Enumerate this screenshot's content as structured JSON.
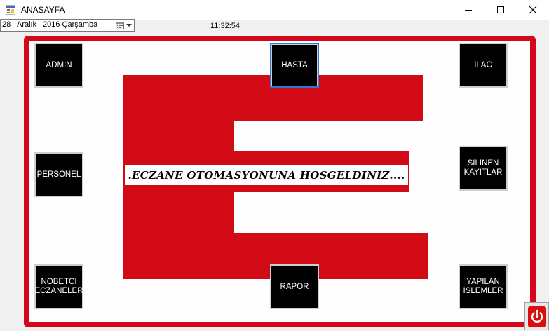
{
  "window": {
    "title": "ANASAYFA",
    "icons": {
      "app": "app-form-icon",
      "minimize": "minimize-icon",
      "maximize": "maximize-icon",
      "close": "close-icon"
    }
  },
  "date_picker": {
    "day": "28",
    "month": "Aralık",
    "year_weekday": "2016 Çarşamba",
    "icon": "calendar-icon"
  },
  "clock": {
    "time": "11:32:54"
  },
  "welcome_text": ".ECZANE OTOMASYONUNA HOSGELDINIZ....",
  "tiles": {
    "admin": "ADMIN",
    "hasta": "HASTA",
    "ilac": "ILAC",
    "personel": "PERSONEL",
    "silinen": "SILINEN KAYITLAR",
    "nobetci": "NOBETCI ECZANELER",
    "rapor": "RAPOR",
    "yapilan": "YAPILAN ISLEMLER"
  },
  "exit_button": {
    "icon": "power-icon"
  },
  "colors": {
    "brand_red": "#d4081a",
    "tile_bg": "#000000",
    "focus_border": "#2a7ad6"
  }
}
